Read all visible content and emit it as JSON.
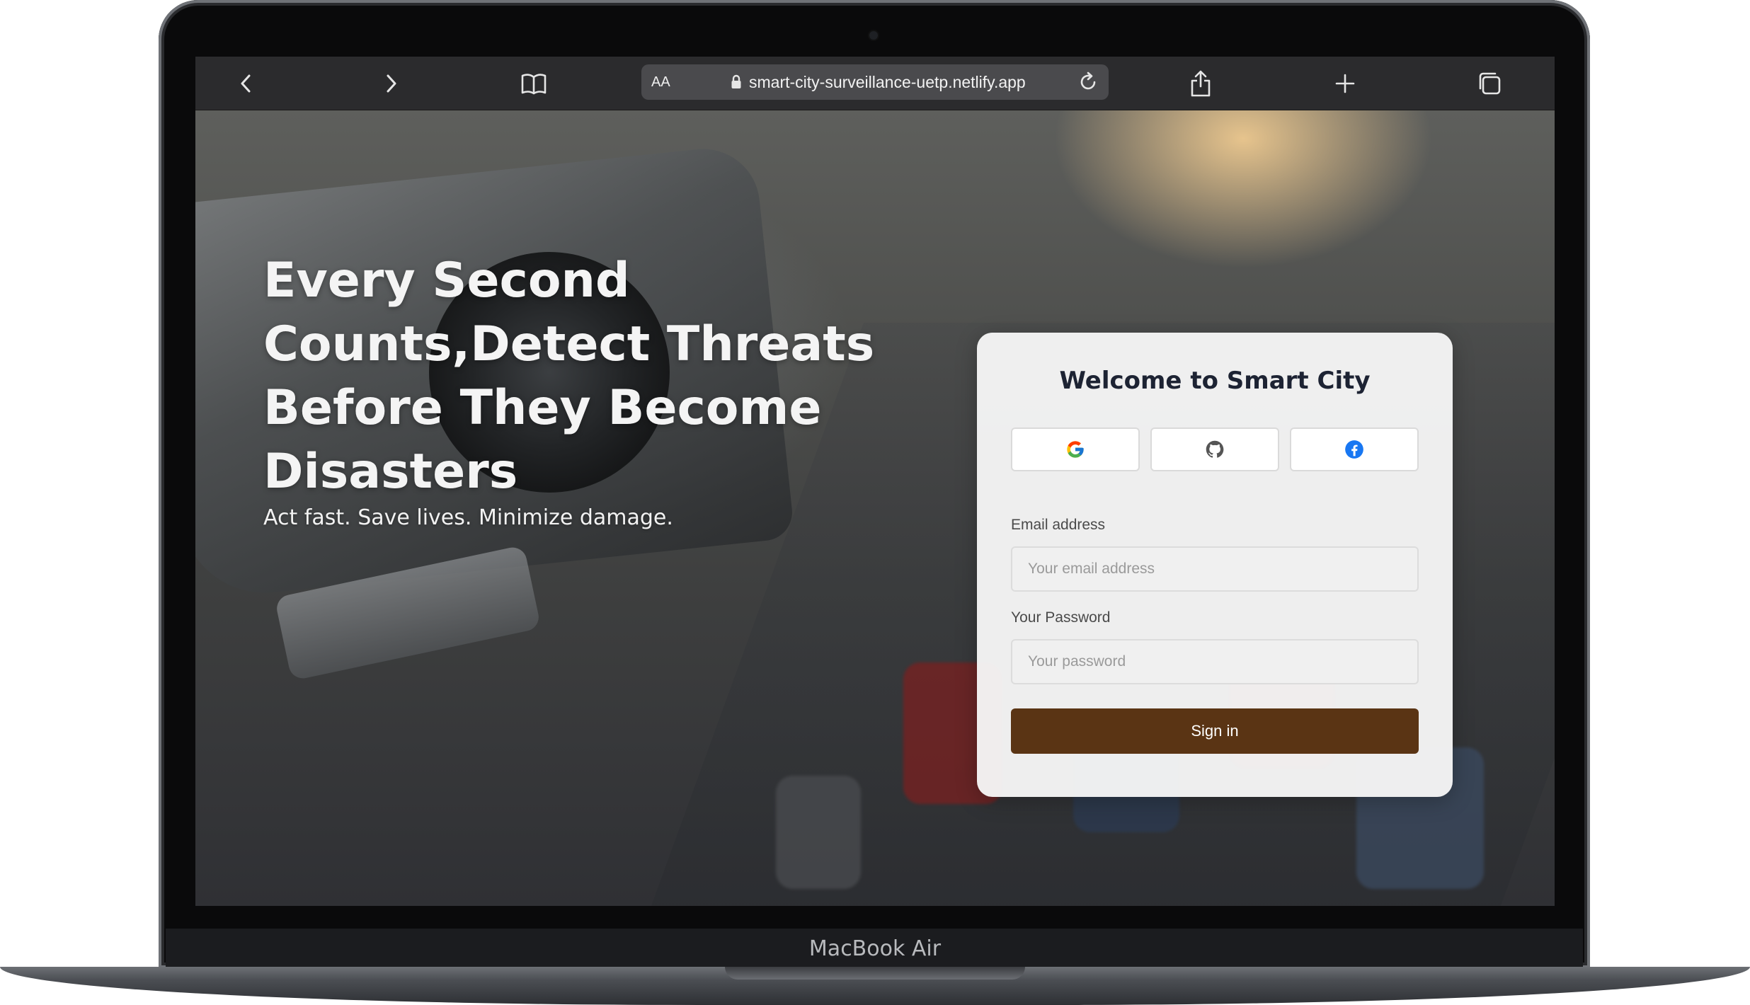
{
  "device": {
    "model_label": "MacBook Air"
  },
  "browser": {
    "text_size_label": "AA",
    "url": "smart-city-surveillance-uetp.netlify.app",
    "icons": [
      "back-icon",
      "forward-icon",
      "bookmarks-icon",
      "lock-icon",
      "reload-icon",
      "share-icon",
      "new-tab-icon",
      "tabs-icon"
    ]
  },
  "hero": {
    "title": "Every Second\nCounts,Detect Threats\nBefore They Become\nDisasters",
    "subtitle": "Act fast. Save lives. Minimize damage."
  },
  "login": {
    "title": "Welcome to Smart City",
    "providers": [
      "google-icon",
      "github-icon",
      "facebook-icon"
    ],
    "email_label": "Email address",
    "email_placeholder": "Your email address",
    "password_label": "Your Password",
    "password_placeholder": "Your password",
    "submit_label": "Sign in"
  },
  "colors": {
    "signin_button": "#5a3414",
    "card_title": "#1d2333",
    "facebook": "#1877f2",
    "toolbar": "#2b2b2d"
  }
}
